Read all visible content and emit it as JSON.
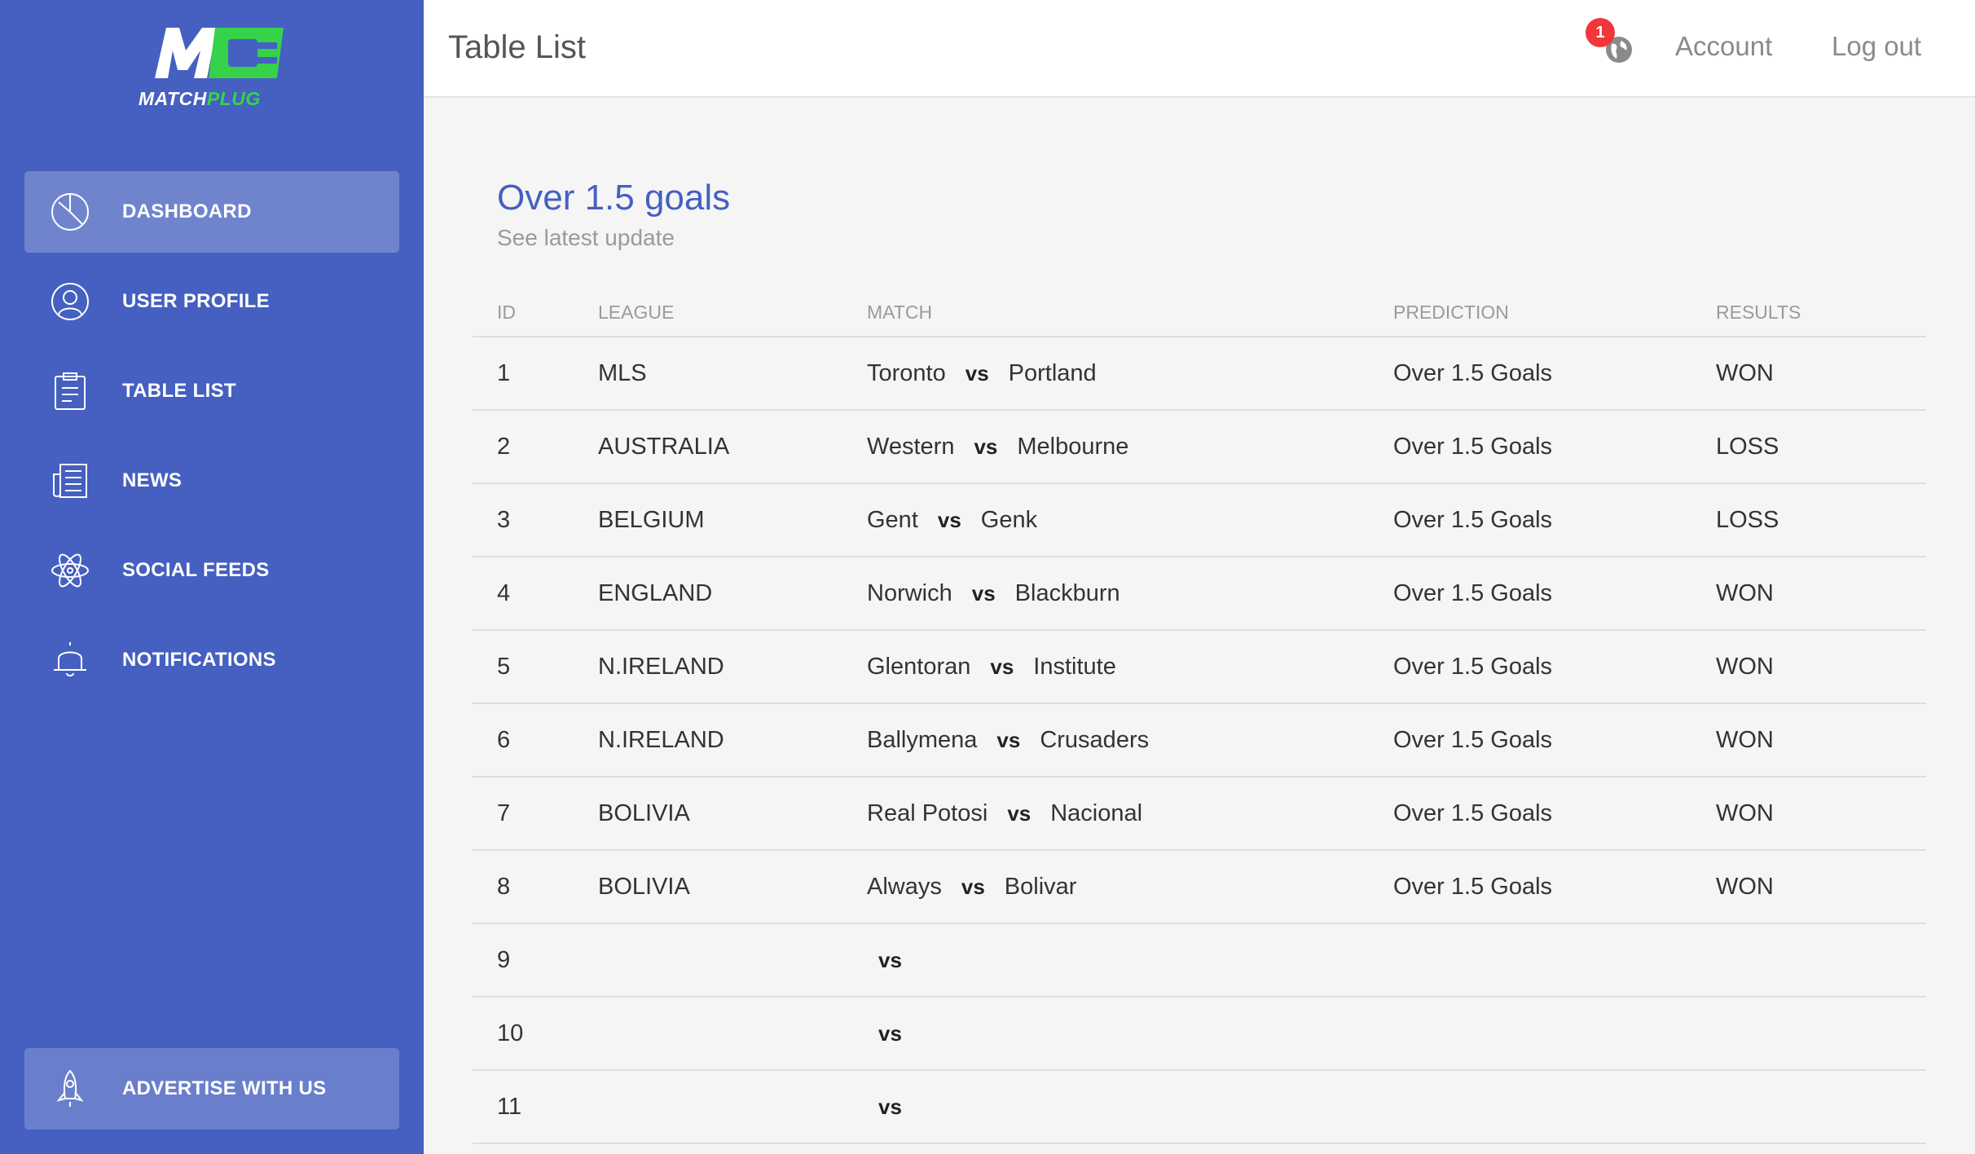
{
  "brand": {
    "logo_part1": "MATCH",
    "logo_part2": "PLUG",
    "primary": "#4560c0",
    "accent": "#35d24a"
  },
  "sidebar": {
    "items": [
      {
        "label": "DASHBOARD",
        "icon": "pie-chart-icon",
        "active": true
      },
      {
        "label": "USER PROFILE",
        "icon": "user-icon",
        "active": false
      },
      {
        "label": "TABLE LIST",
        "icon": "clipboard-icon",
        "active": false
      },
      {
        "label": "NEWS",
        "icon": "newspaper-icon",
        "active": false
      },
      {
        "label": "SOCIAL FEEDS",
        "icon": "atom-icon",
        "active": false
      },
      {
        "label": "NOTIFICATIONS",
        "icon": "bell-icon",
        "active": false
      }
    ],
    "advertise": {
      "label": "ADVERTISE WITH US",
      "icon": "rocket-icon"
    }
  },
  "header": {
    "title": "Table List",
    "notification_count": "1",
    "account": "Account",
    "logout": "Log out"
  },
  "card": {
    "title": "Over 1.5 goals",
    "subtitle": "See latest update"
  },
  "table": {
    "columns": [
      "ID",
      "LEAGUE",
      "MATCH",
      "PREDICTION",
      "RESULTS"
    ],
    "vs": "vs",
    "rows": [
      {
        "id": "1",
        "league": "MLS",
        "home": "Toronto",
        "away": "Portland",
        "prediction": "Over 1.5 Goals",
        "result": "WON"
      },
      {
        "id": "2",
        "league": "AUSTRALIA",
        "home": "Western",
        "away": "Melbourne",
        "prediction": "Over 1.5 Goals",
        "result": "LOSS"
      },
      {
        "id": "3",
        "league": "BELGIUM",
        "home": "Gent",
        "away": "Genk",
        "prediction": "Over 1.5 Goals",
        "result": "LOSS"
      },
      {
        "id": "4",
        "league": "ENGLAND",
        "home": "Norwich",
        "away": "Blackburn",
        "prediction": "Over 1.5 Goals",
        "result": "WON"
      },
      {
        "id": "5",
        "league": "N.IRELAND",
        "home": "Glentoran",
        "away": "Institute",
        "prediction": "Over 1.5 Goals",
        "result": "WON"
      },
      {
        "id": "6",
        "league": "N.IRELAND",
        "home": "Ballymena",
        "away": "Crusaders",
        "prediction": "Over 1.5 Goals",
        "result": "WON"
      },
      {
        "id": "7",
        "league": "BOLIVIA",
        "home": "Real Potosi",
        "away": "Nacional",
        "prediction": "Over 1.5 Goals",
        "result": "WON"
      },
      {
        "id": "8",
        "league": "BOLIVIA",
        "home": "Always",
        "away": "Bolivar",
        "prediction": "Over 1.5 Goals",
        "result": "WON"
      },
      {
        "id": "9",
        "league": "",
        "home": "",
        "away": "",
        "prediction": "",
        "result": ""
      },
      {
        "id": "10",
        "league": "",
        "home": "",
        "away": "",
        "prediction": "",
        "result": ""
      },
      {
        "id": "11",
        "league": "",
        "home": "",
        "away": "",
        "prediction": "",
        "result": ""
      }
    ]
  }
}
